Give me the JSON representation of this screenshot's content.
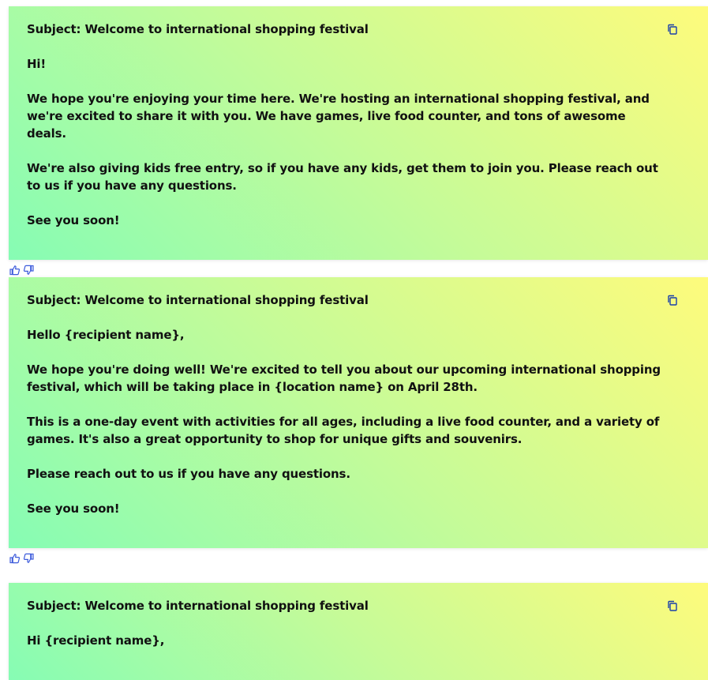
{
  "icons": {
    "copy": "copy-icon",
    "thumbs_up": "thumbs-up-icon",
    "thumbs_down": "thumbs-down-icon"
  },
  "colors": {
    "gradient_start": "#86fcb4",
    "gradient_end": "#fefb7c",
    "feedback_icon": "#3d5bdb"
  },
  "results": [
    {
      "paragraphs": [
        "Subject: Welcome to international shopping festival",
        "Hi!",
        "We hope you're enjoying your time here. We're hosting an international shopping festival, and we're excited to share it with you. We have games, live food counter, and tons of awesome deals.",
        "We're also giving kids free entry, so if you have any kids, get them to join you. Please reach out to us if you have any questions.",
        "See you soon!"
      ]
    },
    {
      "paragraphs": [
        "Subject: Welcome to international shopping festival",
        "Hello {recipient name},",
        "We hope you're doing well! We're excited to tell you about our upcoming international shopping festival, which will be taking place in {location name} on April 28th.",
        "This is a one-day event with activities for all ages, including a live food counter, and a variety of games. It's also a great opportunity to shop for unique gifts and souvenirs.",
        "Please reach out to us if you have any questions.",
        "See you soon!"
      ]
    },
    {
      "paragraphs": [
        "Subject: Welcome to international shopping festival",
        "Hi {recipient name},"
      ]
    }
  ]
}
